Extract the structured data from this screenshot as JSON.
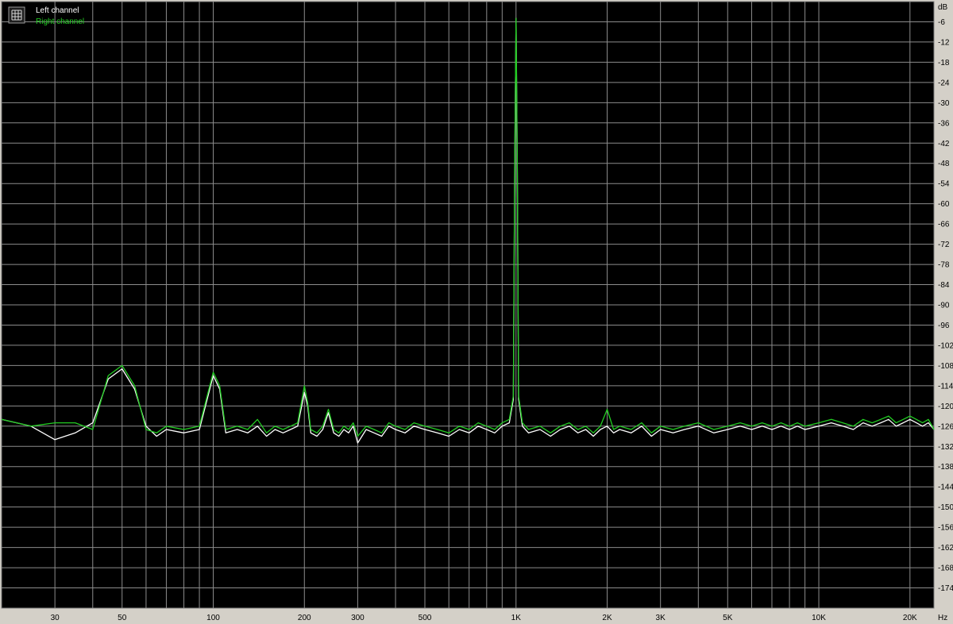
{
  "chart_data": {
    "type": "line",
    "title": "",
    "xlabel": "",
    "ylabel": "",
    "x_unit": "Hz",
    "y_unit": "dB",
    "x_scale": "log",
    "xlim": [
      20,
      24000
    ],
    "ylim": [
      -180,
      0
    ],
    "grid": true,
    "legend_position": "top-left",
    "x_tick_labels": [
      {
        "value": 30,
        "label": "30"
      },
      {
        "value": 50,
        "label": "50"
      },
      {
        "value": 100,
        "label": "100"
      },
      {
        "value": 200,
        "label": "200"
      },
      {
        "value": 300,
        "label": "300"
      },
      {
        "value": 500,
        "label": "500"
      },
      {
        "value": 1000,
        "label": "1K"
      },
      {
        "value": 2000,
        "label": "2K"
      },
      {
        "value": 3000,
        "label": "3K"
      },
      {
        "value": 5000,
        "label": "5K"
      },
      {
        "value": 10000,
        "label": "10K"
      },
      {
        "value": 20000,
        "label": "20K"
      }
    ],
    "y_ticks": [
      -6,
      -12,
      -18,
      -24,
      -30,
      -36,
      -42,
      -48,
      -54,
      -60,
      -66,
      -72,
      -78,
      -84,
      -90,
      -96,
      -102,
      -108,
      -114,
      -120,
      -126,
      -132,
      -138,
      -144,
      -150,
      -156,
      -162,
      -168,
      -174
    ],
    "series": [
      {
        "name": "Left channel",
        "color": "#ffffff",
        "x": [
          20,
          25,
          30,
          35,
          40,
          45,
          50,
          55,
          60,
          65,
          70,
          80,
          90,
          100,
          105,
          110,
          120,
          130,
          140,
          150,
          160,
          170,
          180,
          190,
          200,
          205,
          210,
          220,
          230,
          240,
          250,
          260,
          270,
          280,
          290,
          300,
          320,
          340,
          360,
          380,
          400,
          430,
          460,
          500,
          550,
          600,
          650,
          700,
          750,
          800,
          850,
          900,
          950,
          980,
          990,
          1000,
          1010,
          1020,
          1050,
          1100,
          1200,
          1300,
          1400,
          1500,
          1600,
          1700,
          1800,
          1900,
          2000,
          2100,
          2200,
          2400,
          2600,
          2800,
          3000,
          3300,
          3600,
          4000,
          4500,
          5000,
          5500,
          6000,
          6500,
          7000,
          7500,
          8000,
          8500,
          9000,
          10000,
          11000,
          12000,
          13000,
          14000,
          15000,
          16000,
          17000,
          18000,
          19000,
          20000,
          21000,
          22000,
          23000,
          24000
        ],
        "y": [
          -124,
          -126,
          -130,
          -128,
          -125,
          -112,
          -109,
          -115,
          -126,
          -129,
          -127,
          -128,
          -127,
          -111,
          -115,
          -128,
          -127,
          -128,
          -126,
          -129,
          -127,
          -128,
          -127,
          -126,
          -116,
          -120,
          -128,
          -129,
          -127,
          -122,
          -128,
          -129,
          -127,
          -128,
          -126,
          -131,
          -127,
          -128,
          -129,
          -126,
          -127,
          -128,
          -126,
          -127,
          -128,
          -129,
          -127,
          -128,
          -126,
          -127,
          -128,
          -126,
          -125,
          -118,
          -50,
          -5,
          -50,
          -118,
          -126,
          -128,
          -127,
          -129,
          -127,
          -126,
          -128,
          -127,
          -129,
          -127,
          -126,
          -128,
          -127,
          -128,
          -126,
          -129,
          -127,
          -128,
          -127,
          -126,
          -128,
          -127,
          -126,
          -127,
          -126,
          -127,
          -126,
          -127,
          -126,
          -127,
          -126,
          -125,
          -126,
          -127,
          -125,
          -126,
          -125,
          -124,
          -126,
          -125,
          -124,
          -125,
          -126,
          -125,
          -127
        ]
      },
      {
        "name": "Right channel",
        "color": "#22cc22",
        "x": [
          20,
          25,
          30,
          35,
          40,
          45,
          50,
          55,
          60,
          65,
          70,
          80,
          90,
          100,
          105,
          110,
          120,
          130,
          140,
          150,
          160,
          170,
          180,
          190,
          200,
          205,
          210,
          220,
          230,
          240,
          250,
          260,
          270,
          280,
          290,
          300,
          320,
          340,
          360,
          380,
          400,
          430,
          460,
          500,
          550,
          600,
          650,
          700,
          750,
          800,
          850,
          900,
          950,
          980,
          990,
          1000,
          1010,
          1020,
          1050,
          1100,
          1200,
          1300,
          1400,
          1500,
          1600,
          1700,
          1800,
          1900,
          2000,
          2100,
          2200,
          2400,
          2600,
          2800,
          3000,
          3300,
          3600,
          4000,
          4500,
          5000,
          5500,
          6000,
          6500,
          7000,
          7500,
          8000,
          8500,
          9000,
          10000,
          11000,
          12000,
          13000,
          14000,
          15000,
          16000,
          17000,
          18000,
          19000,
          20000,
          21000,
          22000,
          23000,
          24000
        ],
        "y": [
          -124,
          -126,
          -125,
          -125,
          -127,
          -111,
          -108,
          -114,
          -127,
          -128,
          -126,
          -127,
          -126,
          -110,
          -114,
          -127,
          -126,
          -127,
          -124,
          -128,
          -126,
          -127,
          -126,
          -125,
          -114,
          -119,
          -127,
          -128,
          -126,
          -121,
          -127,
          -128,
          -126,
          -127,
          -125,
          -129,
          -126,
          -127,
          -128,
          -125,
          -126,
          -127,
          -125,
          -126,
          -127,
          -128,
          -126,
          -127,
          -125,
          -126,
          -127,
          -125,
          -124,
          -117,
          -48,
          -5,
          -48,
          -117,
          -125,
          -127,
          -126,
          -128,
          -126,
          -125,
          -127,
          -126,
          -128,
          -126,
          -121,
          -127,
          -126,
          -127,
          -125,
          -128,
          -126,
          -127,
          -126,
          -125,
          -127,
          -126,
          -125,
          -126,
          -125,
          -126,
          -125,
          -126,
          -125,
          -126,
          -125,
          -124,
          -125,
          -126,
          -124,
          -125,
          -124,
          -123,
          -125,
          -124,
          -123,
          -124,
          -125,
          -124,
          -127
        ]
      }
    ]
  }
}
